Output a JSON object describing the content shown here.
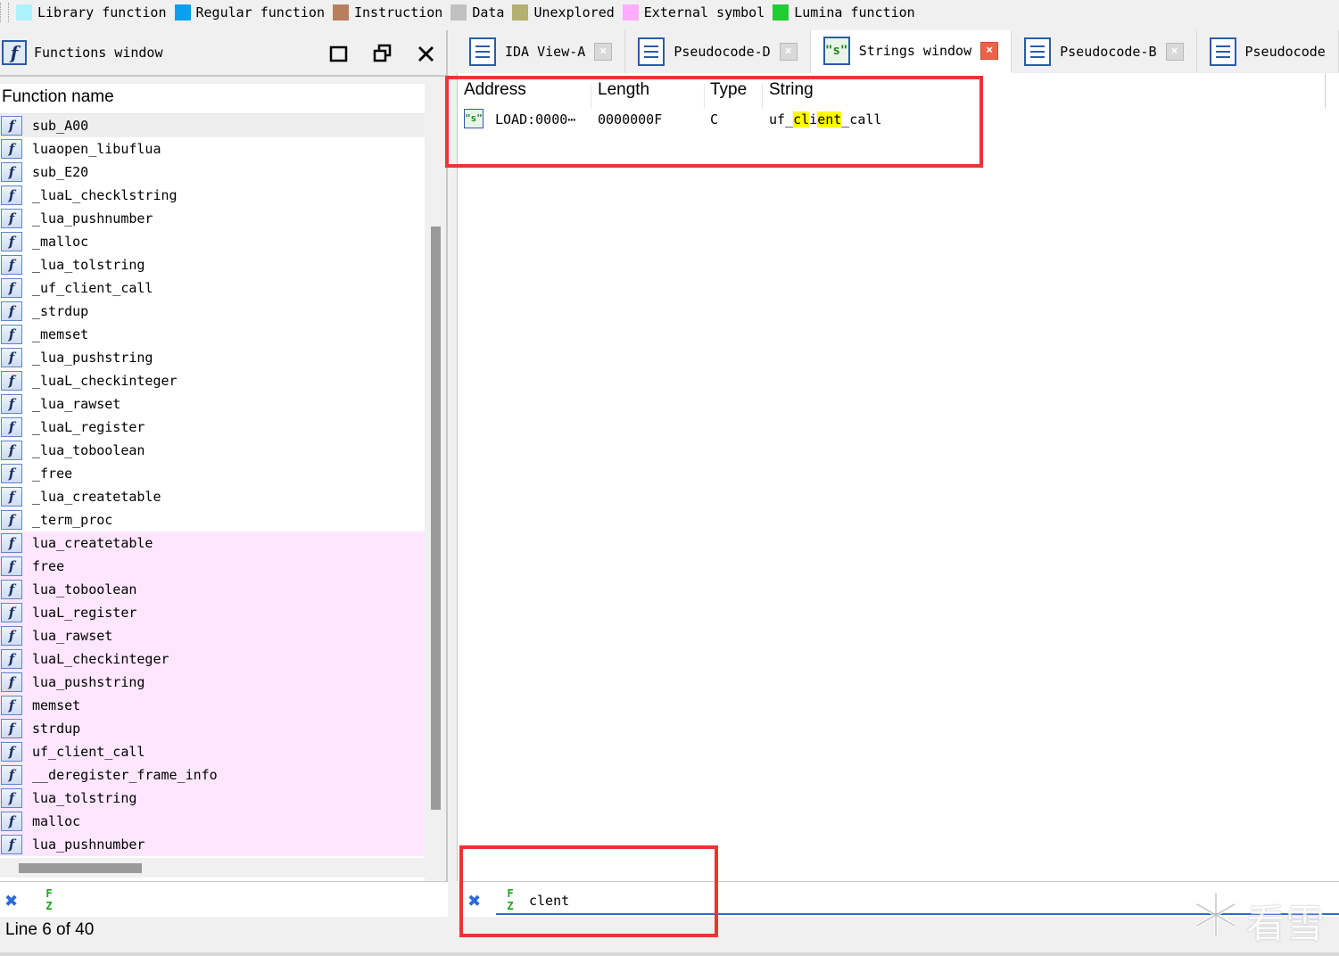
{
  "legend": [
    {
      "label": "Library function",
      "color": "#aef2fd"
    },
    {
      "label": "Regular function",
      "color": "#0aa0f0"
    },
    {
      "label": "Instruction",
      "color": "#b87f5f"
    },
    {
      "label": "Data",
      "color": "#c0c0c0"
    },
    {
      "label": "Unexplored",
      "color": "#b4b070"
    },
    {
      "label": "External symbol",
      "color": "#ffabff"
    },
    {
      "label": "Lumina function",
      "color": "#22cc33"
    }
  ],
  "functions_window": {
    "title": "Functions window",
    "column_header": "Function name",
    "functions": [
      {
        "name": "sub_A00",
        "style": "sel"
      },
      {
        "name": "luaopen_libuflua",
        "style": ""
      },
      {
        "name": "sub_E20",
        "style": ""
      },
      {
        "name": "_luaL_checklstring",
        "style": ""
      },
      {
        "name": "_lua_pushnumber",
        "style": ""
      },
      {
        "name": "_malloc",
        "style": ""
      },
      {
        "name": "_lua_tolstring",
        "style": ""
      },
      {
        "name": "_uf_client_call",
        "style": ""
      },
      {
        "name": "_strdup",
        "style": ""
      },
      {
        "name": "_memset",
        "style": ""
      },
      {
        "name": "_lua_pushstring",
        "style": ""
      },
      {
        "name": "_luaL_checkinteger",
        "style": ""
      },
      {
        "name": "_lua_rawset",
        "style": ""
      },
      {
        "name": "_luaL_register",
        "style": ""
      },
      {
        "name": "_lua_toboolean",
        "style": ""
      },
      {
        "name": "_free",
        "style": ""
      },
      {
        "name": "_lua_createtable",
        "style": ""
      },
      {
        "name": "_term_proc",
        "style": ""
      },
      {
        "name": "lua_createtable",
        "style": "ext"
      },
      {
        "name": "free",
        "style": "ext"
      },
      {
        "name": "lua_toboolean",
        "style": "ext"
      },
      {
        "name": "luaL_register",
        "style": "ext"
      },
      {
        "name": "lua_rawset",
        "style": "ext"
      },
      {
        "name": "luaL_checkinteger",
        "style": "ext"
      },
      {
        "name": "lua_pushstring",
        "style": "ext"
      },
      {
        "name": "memset",
        "style": "ext"
      },
      {
        "name": "strdup",
        "style": "ext"
      },
      {
        "name": "uf_client_call",
        "style": "ext"
      },
      {
        "name": "__deregister_frame_info",
        "style": "ext"
      },
      {
        "name": "lua_tolstring",
        "style": "ext"
      },
      {
        "name": "malloc",
        "style": "ext"
      },
      {
        "name": "lua_pushnumber",
        "style": "ext"
      }
    ],
    "filter_text": "",
    "status": "Line 6 of 40"
  },
  "tabs": [
    {
      "label": "IDA View-A",
      "icon": "document-icon",
      "active": false
    },
    {
      "label": "Pseudocode-D",
      "icon": "document-icon",
      "active": false
    },
    {
      "label": "Strings window",
      "icon": "strings-icon",
      "active": true
    },
    {
      "label": "Pseudocode-B",
      "icon": "document-icon",
      "active": false
    },
    {
      "label": "Pseudocode",
      "icon": "document-icon",
      "active": false
    }
  ],
  "strings_window": {
    "columns": [
      "Address",
      "Length",
      "Type",
      "String"
    ],
    "rows": [
      {
        "address": "LOAD:0000⋯",
        "length": "0000000F",
        "type": "C",
        "string_parts": [
          {
            "text": "uf_",
            "hl": false
          },
          {
            "text": "cl",
            "hl": true
          },
          {
            "text": "i",
            "hl": false
          },
          {
            "text": "ent",
            "hl": true
          },
          {
            "text": "_call",
            "hl": false
          }
        ]
      }
    ],
    "filter_text": "clent"
  },
  "watermark": "看雪",
  "colors": {
    "highlight": "#ffff00",
    "annotation_box": "#ee3333",
    "external_symbol_bg": "#ffe6ff",
    "accent": "#2a6cd6"
  }
}
